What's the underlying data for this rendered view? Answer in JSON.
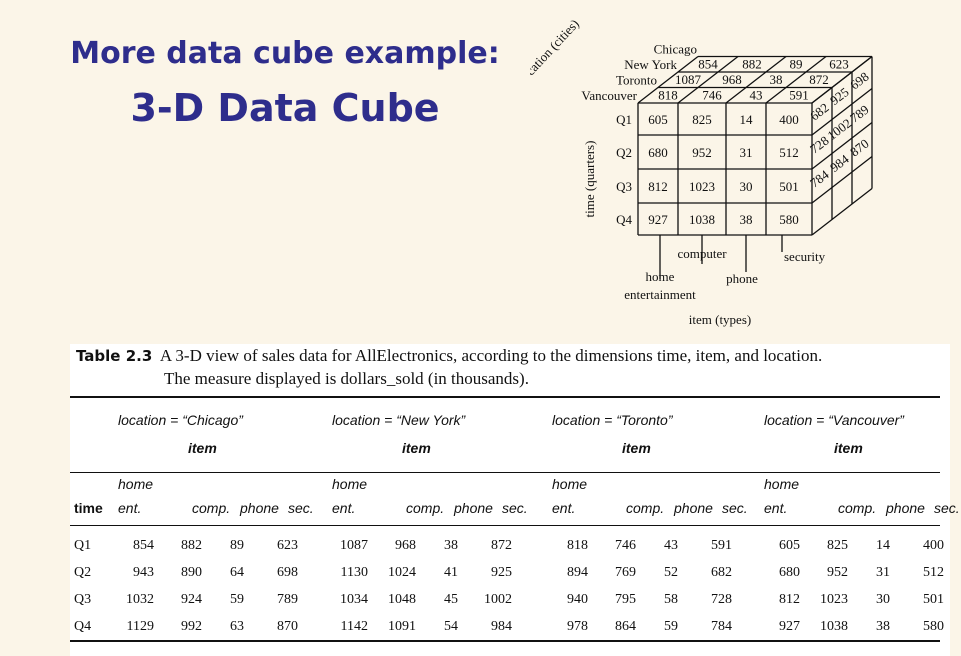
{
  "slide": {
    "title_line1": "More data cube example:",
    "title_line2": "3-D Data Cube"
  },
  "cube": {
    "axis_location": "location (cities)",
    "axis_time": "time (quarters)",
    "axis_item": "item (types)",
    "cities_back_to_front": [
      "Chicago",
      "New York",
      "Toronto",
      "Vancouver"
    ],
    "quarters": [
      "Q1",
      "Q2",
      "Q3",
      "Q4"
    ],
    "item_labels": {
      "computer": "computer",
      "security": "security",
      "home": "home",
      "entertainment": "entertainment",
      "phone": "phone"
    },
    "front_face": [
      [
        605,
        825,
        14,
        400
      ],
      [
        680,
        952,
        31,
        512
      ],
      [
        812,
        1023,
        30,
        501
      ],
      [
        927,
        1038,
        38,
        580
      ]
    ],
    "top_rows": {
      "Chicago": [
        854,
        882,
        89,
        623
      ],
      "New York": [
        1087,
        968,
        38,
        872
      ],
      "Toronto": [
        818,
        746,
        43,
        591
      ]
    },
    "side_rows": {
      "Q1": [
        682,
        925,
        698
      ],
      "Q2": [
        728,
        1002,
        789
      ],
      "Q3": [
        784,
        984,
        870
      ]
    }
  },
  "table": {
    "caption_label": "Table 2.3",
    "caption_line1": "A 3-D view of sales data for AllElectronics, according to the dimensions time, item, and location.",
    "caption_line2": "The measure displayed is dollars_sold (in thousands).",
    "location_headers": [
      "location = “Chicago”",
      "location = “New York”",
      "location = “Toronto”",
      "location = “Vancouver”"
    ],
    "item_header": "item",
    "time_header": "time",
    "col_home": "home",
    "col_headers": [
      "ent.",
      "comp.",
      "phone",
      "sec."
    ],
    "rows": [
      {
        "time": "Q1",
        "values": [
          854,
          882,
          89,
          623,
          1087,
          968,
          38,
          872,
          818,
          746,
          43,
          591,
          605,
          825,
          14,
          400
        ]
      },
      {
        "time": "Q2",
        "values": [
          943,
          890,
          64,
          698,
          1130,
          1024,
          41,
          925,
          894,
          769,
          52,
          682,
          680,
          952,
          31,
          512
        ]
      },
      {
        "time": "Q3",
        "values": [
          1032,
          924,
          59,
          789,
          1034,
          1048,
          45,
          1002,
          940,
          795,
          58,
          728,
          812,
          1023,
          30,
          501
        ]
      },
      {
        "time": "Q4",
        "values": [
          1129,
          992,
          63,
          870,
          1142,
          1091,
          54,
          984,
          978,
          864,
          59,
          784,
          927,
          1038,
          38,
          580
        ]
      }
    ]
  }
}
